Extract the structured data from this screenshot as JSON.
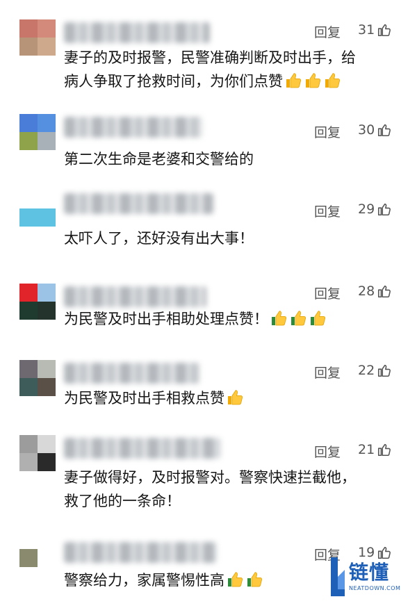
{
  "reply_label": "回复",
  "comments": [
    {
      "text_lines": [
        "妻子的及时报警，民警准确判断及时出手，给",
        "病人争取了抢救时间，为你们点赞"
      ],
      "emoji_count": 3,
      "likes": "31",
      "avatar": [
        "#c8766a",
        "#d48a7a",
        "#b79477",
        "#cfa98b"
      ]
    },
    {
      "text_lines": [
        "第二次生命是老婆和交警给的"
      ],
      "emoji_count": 0,
      "likes": "30",
      "avatar": [
        "#4a7dd8",
        "#5590e0",
        "#8fa34a",
        "#a8b0b8"
      ]
    },
    {
      "text_lines": [
        "太吓人了，还好没有出大事！"
      ],
      "emoji_count": 0,
      "likes": "29",
      "avatar": [
        "#ffffff",
        "#ffffff",
        "#5ec2e2",
        "#5ec2e2"
      ]
    },
    {
      "text_lines": [
        "为民警及时出手相助处理点赞！"
      ],
      "emoji_count": 3,
      "likes": "28",
      "avatar": [
        "#e0242a",
        "#9ac3e6",
        "#1f3a2e",
        "#24332c"
      ]
    },
    {
      "text_lines": [
        "为民警及时出手相救点赞"
      ],
      "emoji_count": 1,
      "likes": "22",
      "avatar": [
        "#6e6870",
        "#b8bab4",
        "#3e5c5a",
        "#5a5048"
      ]
    },
    {
      "text_lines": [
        "妻子做得好，及时报警对。警察快速拦截他，",
        "救了他的一条命！"
      ],
      "emoji_count": 0,
      "likes": "21",
      "avatar": [
        "#9c9c9c",
        "#d8d8d8",
        "#b0b0b0",
        "#2a2a2a"
      ]
    },
    {
      "text_lines": [
        "警察给力，家属警惕性高"
      ],
      "emoji_count": 2,
      "likes": "19",
      "avatar": [
        "#8a8a6e",
        "#8a8a6e",
        "#ffffff",
        "#ffffff"
      ]
    }
  ],
  "watermark": {
    "brand": "链懂",
    "site": "NEATDOWN.COM",
    "color": "#1e5fb8"
  }
}
